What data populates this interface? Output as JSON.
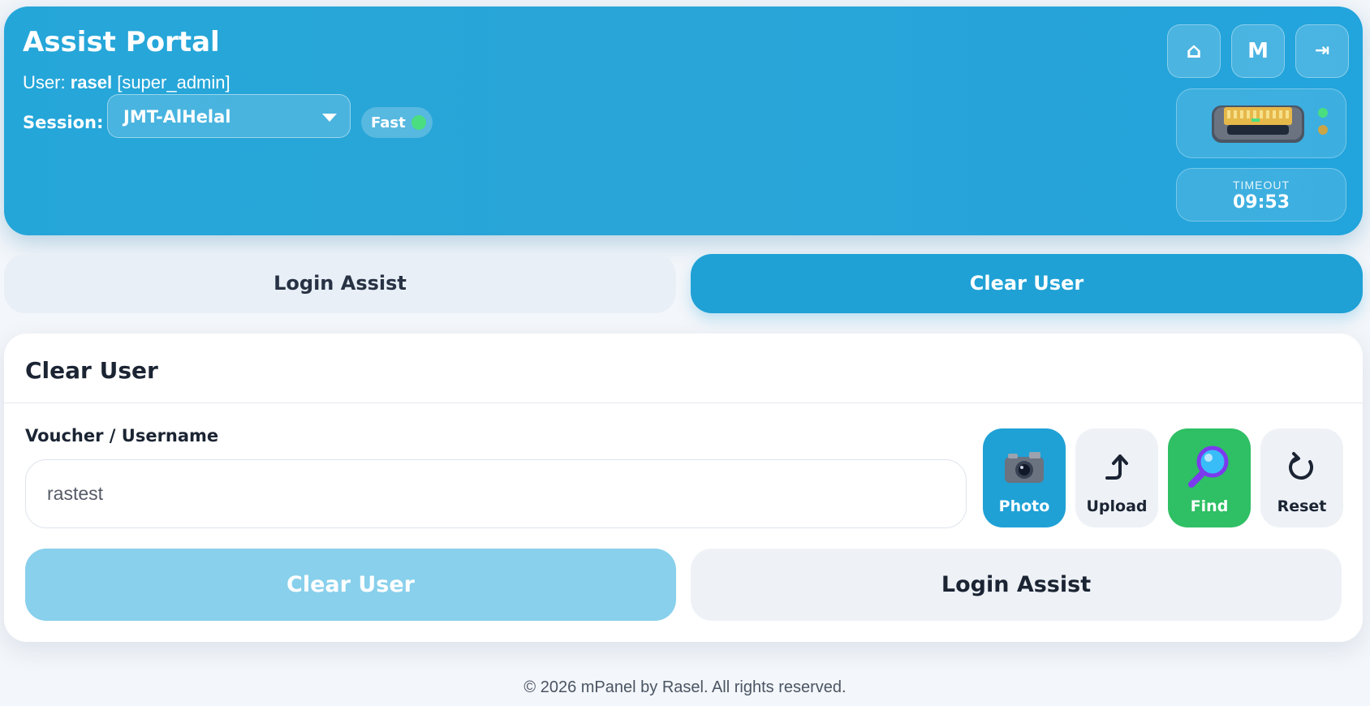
{
  "header": {
    "title": "Assist Portal",
    "user_prefix": "User:",
    "username": "rasel",
    "role": "[super_admin]",
    "session_label": "Session:",
    "session_value": "JMT-AlHelal",
    "speed_label": "Fast",
    "speed_status_color": "#4ade80",
    "buttons": [
      {
        "icon": "home-icon",
        "label": "⌂"
      },
      {
        "icon": "menu-icon",
        "label": "M"
      },
      {
        "icon": "logout-icon",
        "label": "⇥"
      }
    ],
    "router_icon": "router-icon",
    "timeout_label": "TIMEOUT",
    "timeout_value": "09:53"
  },
  "tabs": [
    {
      "label": "Login Assist",
      "active": false
    },
    {
      "label": "Clear User",
      "active": true
    }
  ],
  "card": {
    "title": "Clear User",
    "field_label": "Voucher / Username",
    "input_value": "rastest",
    "actions": [
      {
        "label": "Photo",
        "icon": "camera-icon"
      },
      {
        "label": "Upload",
        "icon": "upload-arrow-icon"
      },
      {
        "label": "Find",
        "icon": "magnifier-icon"
      },
      {
        "label": "Reset",
        "icon": "refresh-icon"
      }
    ],
    "primary_button": "Clear User",
    "secondary_button": "Login Assist"
  },
  "footer": {
    "text": "© 2026 mPanel by Rasel. All rights reserved."
  },
  "colors": {
    "header_bg": "#25a6d9",
    "accent": "#1fa1d6",
    "find_green": "#2fbf64"
  }
}
